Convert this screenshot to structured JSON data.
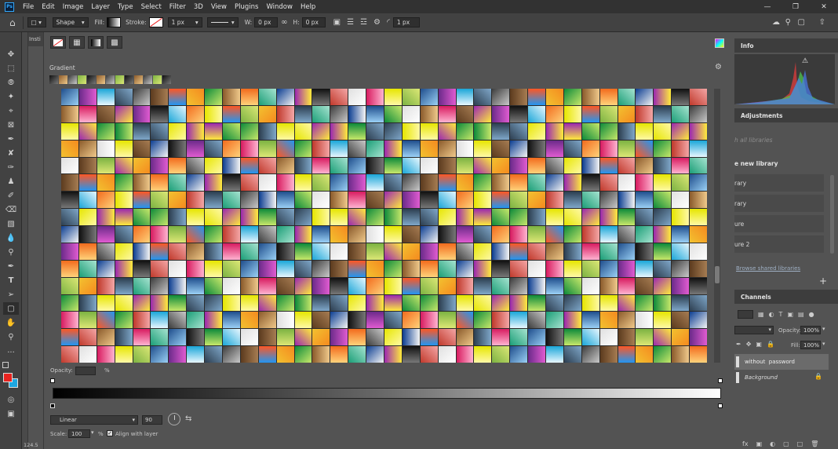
{
  "menu": {
    "items": [
      "File",
      "Edit",
      "Image",
      "Layer",
      "Type",
      "Select",
      "Filter",
      "3D",
      "View",
      "Plugins",
      "Window",
      "Help"
    ]
  },
  "options": {
    "shape_mode": "Shape",
    "fill_label": "Fill:",
    "stroke_label": "Stroke:",
    "stroke_width": "1 px",
    "w_label": "W:",
    "w_value": "0 px",
    "h_label": "H:",
    "h_value": "0 px",
    "radius_value": "1 px"
  },
  "tab": {
    "partial_label": "Insti"
  },
  "dialog": {
    "section_title": "Gradient",
    "opacity_label": "Opacity:",
    "opacity_unit": "%",
    "type_value": "Linear",
    "angle_value": "90",
    "scale_label": "Scale:",
    "scale_value": "100",
    "scale_unit": "%",
    "align_label": "Align with layer"
  },
  "right": {
    "info_tab": "Info",
    "adjustments_tab": "Adjustments",
    "search_placeholder": "h all libraries",
    "new_library": "e new library",
    "lib_items": [
      "rary",
      "rary",
      "ure",
      "ure 2"
    ],
    "browse_shared": "Browse shared libraries",
    "channels_tab": "Channels",
    "opacity_label": "Opacity:",
    "opacity_value": "100%",
    "fill_label": "Fill:",
    "fill_value": "100%",
    "layers": [
      "without  password",
      "Background"
    ]
  },
  "status": {
    "zoom": "124.5"
  },
  "colors": {
    "foreground": "#e8231f",
    "background": "#1ea7e1",
    "accent": "#31a8ff"
  }
}
